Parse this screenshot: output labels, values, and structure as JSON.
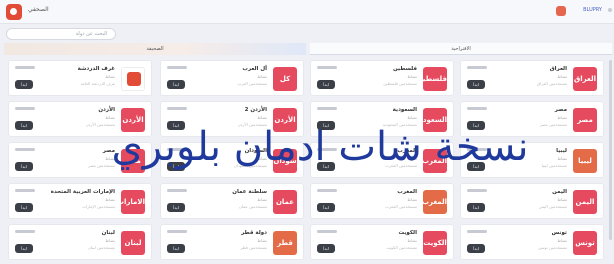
{
  "app": {
    "title": "الصحفي",
    "user_name": "BLUPRY"
  },
  "search": {
    "placeholder": "البحث عن دولة"
  },
  "sections": {
    "right": "الاقتراحية",
    "left": "الصحيفة"
  },
  "cards": [
    {
      "name": "العراق",
      "sub": "نشاط",
      "desc": "مستخدمين العراق",
      "logo": "العراق",
      "btn": "ابدأ"
    },
    {
      "name": "فلسطين",
      "sub": "نشاط",
      "desc": "مستخدمين فلسطين",
      "logo": "فلسطين",
      "btn": "ابدأ"
    },
    {
      "name": "آل العرب",
      "sub": "نشاط",
      "desc": "مستخدمين العرب",
      "logo": "كل العرب",
      "btn": "ابدأ"
    },
    {
      "name": "غرف الدردشة",
      "sub": "نشاط",
      "desc": "غرف الدردشة العامة",
      "logo": "",
      "btn": "ابدأ"
    },
    {
      "name": "مصر",
      "sub": "نشاط",
      "desc": "مستخدمين مصر",
      "logo": "مصر",
      "btn": "ابدأ"
    },
    {
      "name": "السعودية",
      "sub": "نشاط",
      "desc": "مستخدمين السعودية",
      "logo": "السعودية",
      "btn": "ابدأ"
    },
    {
      "name": "الأردن 2",
      "sub": "نشاط",
      "desc": "مستخدمين الأردن",
      "logo": "الأردن",
      "btn": "ابدأ"
    },
    {
      "name": "الأردن",
      "sub": "نشاط",
      "desc": "مستخدمين الأردن",
      "logo": "الأردن",
      "btn": "ابدأ"
    },
    {
      "name": "ليبيا",
      "sub": "نشاط",
      "desc": "مستخدمين ليبيا",
      "logo": "ليبيا",
      "btn": "ابدأ"
    },
    {
      "name": "المغرب",
      "sub": "نشاط",
      "desc": "مستخدمين المغرب",
      "logo": "المغرب",
      "btn": "ابدأ"
    },
    {
      "name": "السودان",
      "sub": "نشاط",
      "desc": "مستخدمين السودان",
      "logo": "سودان",
      "btn": "ابدأ"
    },
    {
      "name": "مصر",
      "sub": "نشاط",
      "desc": "مستخدمين مصر",
      "logo": "مصر",
      "btn": "ابدأ"
    },
    {
      "name": "اليمن",
      "sub": "نشاط",
      "desc": "مستخدمين اليمن",
      "logo": "اليمن",
      "btn": "ابدأ"
    },
    {
      "name": "المغرب",
      "sub": "نشاط",
      "desc": "مستخدمين المغرب",
      "logo": "المغرب",
      "btn": "ابدأ"
    },
    {
      "name": "سلطنة عمان",
      "sub": "نشاط",
      "desc": "مستخدمين عمان",
      "logo": "عمان",
      "btn": "ابدأ"
    },
    {
      "name": "الإمارات العربية المتحدة",
      "sub": "نشاط",
      "desc": "مستخدمين الإمارات",
      "logo": "الامارات",
      "btn": "ابدأ"
    },
    {
      "name": "تونس",
      "sub": "نشاط",
      "desc": "مستخدمين تونس",
      "logo": "تونس",
      "btn": "ابدأ"
    },
    {
      "name": "الكويت",
      "sub": "نشاط",
      "desc": "مستخدمين الكويت",
      "logo": "الكويت",
      "btn": "ابدأ"
    },
    {
      "name": "دولة قطر",
      "sub": "نشاط",
      "desc": "مستخدمين قطر",
      "logo": "قطر",
      "btn": "ابدأ"
    },
    {
      "name": "لبنان",
      "sub": "نشاط",
      "desc": "مستخدمين لبنان",
      "logo": "لبنان",
      "btn": "ابدأ"
    }
  ],
  "watermark": "نسخة شات ادمان بلوبري",
  "colors": {
    "brand": "#e24b36",
    "card_logo": "#e64a5e",
    "watermark": "#1f3a9c"
  }
}
